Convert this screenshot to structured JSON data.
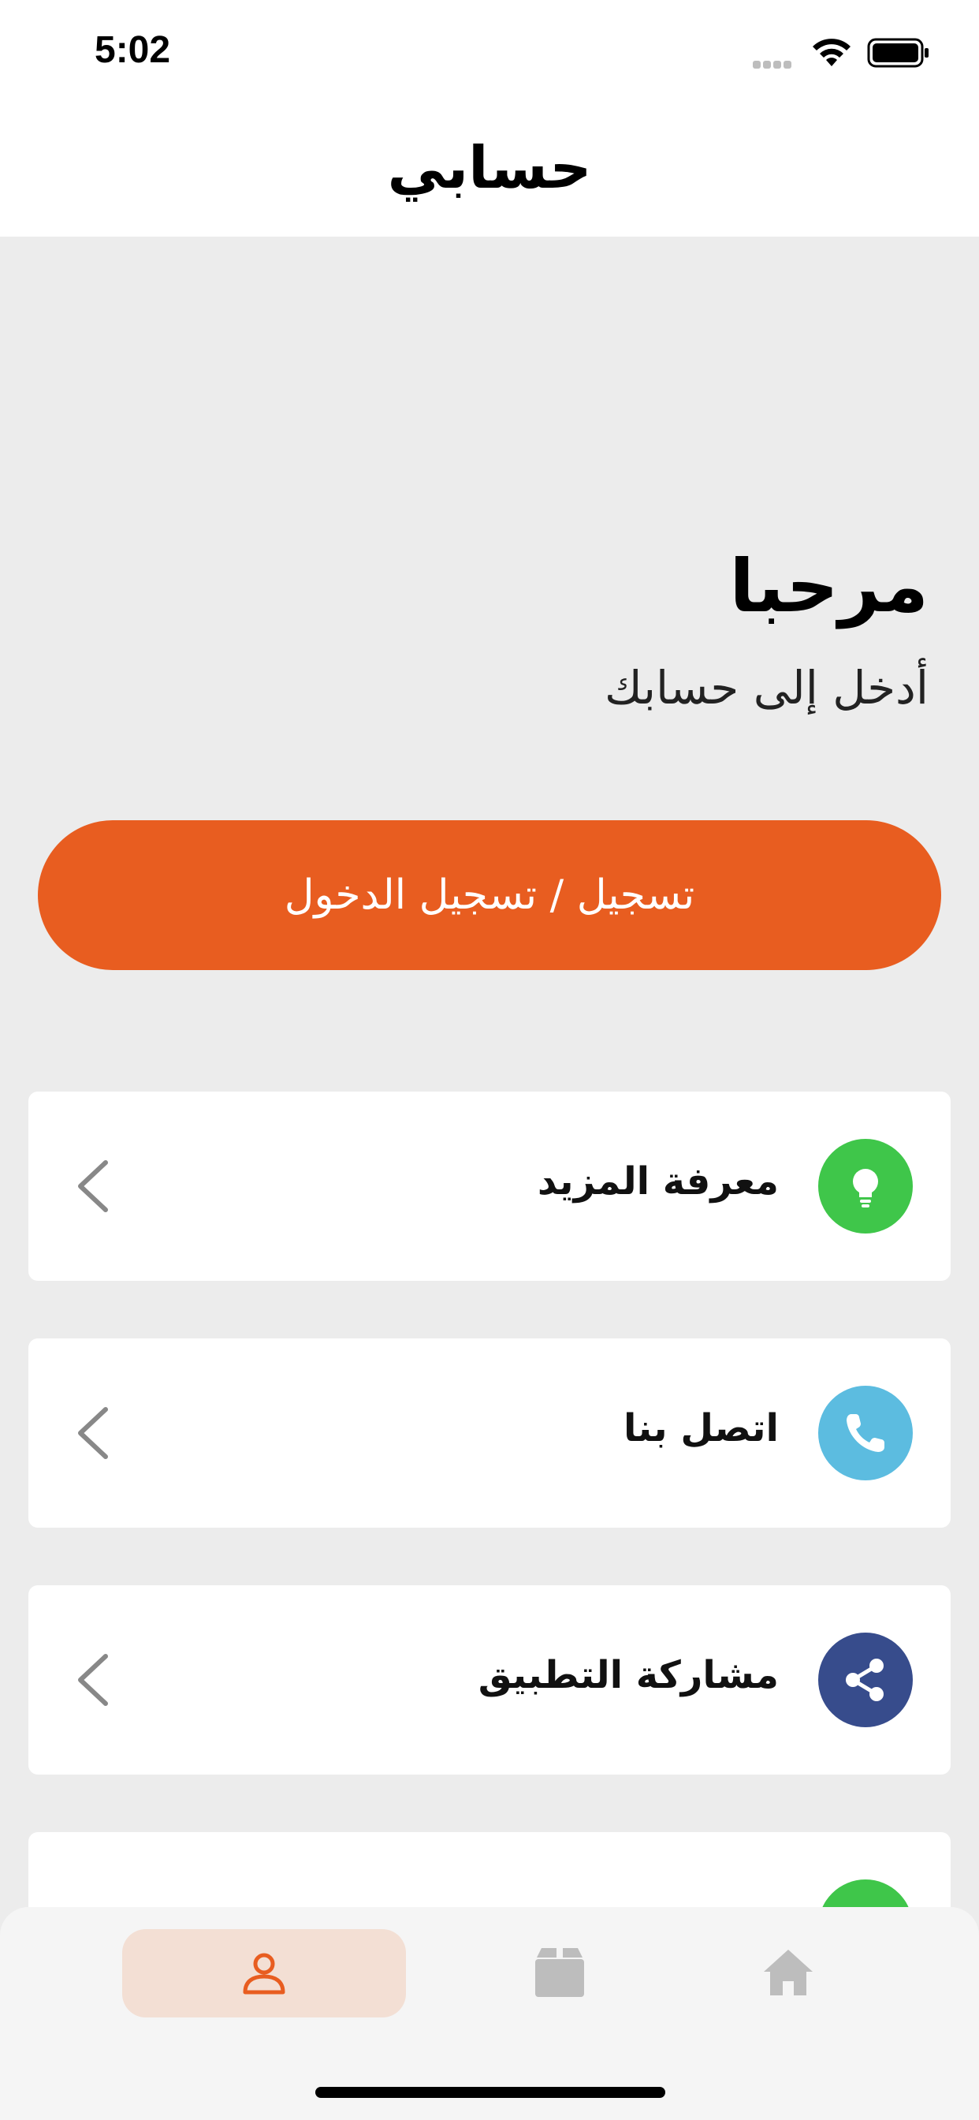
{
  "status_bar": {
    "time": "5:02"
  },
  "header": {
    "title": "حسابي"
  },
  "welcome": {
    "title": "مرحبا",
    "subtitle": "أدخل إلى حسابك"
  },
  "login_button": {
    "label": "تسجيل / تسجيل الدخول"
  },
  "menu": [
    {
      "label": "معرفة المزيد",
      "icon": "lightbulb-icon",
      "color": "#3fc64a"
    },
    {
      "label": "اتصل بنا",
      "icon": "phone-icon",
      "color": "#5cbce0"
    },
    {
      "label": "مشاركة التطبيق",
      "icon": "share-icon",
      "color": "#374c8c"
    },
    {
      "label": "",
      "icon": "partial-icon",
      "color": "#3fc64a"
    }
  ],
  "tab_bar": {
    "tabs": [
      {
        "icon": "user-icon",
        "active": true
      },
      {
        "icon": "box-icon",
        "active": false
      },
      {
        "icon": "home-icon",
        "active": false
      }
    ]
  },
  "colors": {
    "accent": "#e85d20",
    "tab_active_bg": "#f3dfd4"
  }
}
